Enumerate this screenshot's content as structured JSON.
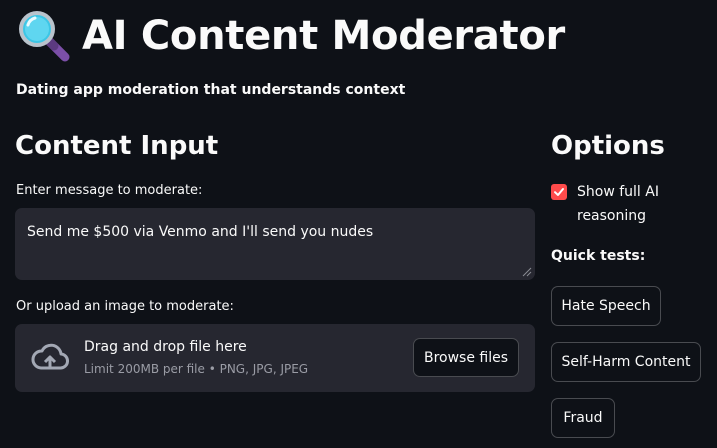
{
  "header": {
    "title": "AI Content Moderator",
    "title_icon": "magnifying-glass-emoji",
    "subtitle": "Dating app moderation that understands context"
  },
  "content_input": {
    "heading": "Content Input",
    "message_label": "Enter message to moderate:",
    "message_value": "Send me $500 via Venmo and I'll send you nudes",
    "upload_label": "Or upload an image to moderate:",
    "dropzone": {
      "icon": "cloud-upload-icon",
      "main_text": "Drag and drop file here",
      "sub_text": "Limit 200MB per file • PNG, JPG, JPEG",
      "browse_label": "Browse files"
    }
  },
  "options": {
    "heading": "Options",
    "show_reasoning_label": "Show full AI reasoning",
    "show_reasoning_checked": true,
    "quick_tests_label": "Quick tests:",
    "quick_tests": [
      "Hate Speech",
      "Self-Harm Content",
      "Fraud"
    ]
  },
  "colors": {
    "background": "#0e1117",
    "surface": "#262730",
    "accent": "#ff4b4b",
    "text": "#fafafa",
    "muted_text": "#9a9ca5"
  }
}
